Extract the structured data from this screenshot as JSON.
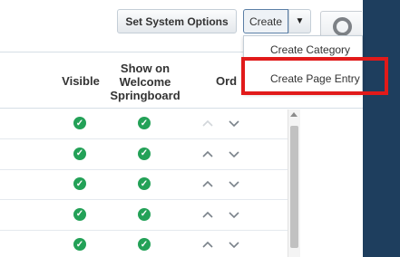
{
  "toolbar": {
    "system_options_label": "Set System Options",
    "create_label": "Create",
    "caret": "▼"
  },
  "create_menu": {
    "items": [
      "Create Category",
      "Create Page Entry"
    ],
    "highlighted_item": "Create Page Entry",
    "highlight_color": "#e11a1a"
  },
  "table": {
    "columns": [
      "Visible",
      "Show on Welcome Springboard",
      "Ord"
    ],
    "rows": [
      {
        "visible": true,
        "show_on_welcome": true
      },
      {
        "visible": true,
        "show_on_welcome": true
      },
      {
        "visible": true,
        "show_on_welcome": true
      },
      {
        "visible": true,
        "show_on_welcome": true
      },
      {
        "visible": true,
        "show_on_welcome": true
      }
    ],
    "check_icon": "check-circle-icon",
    "check_color": "#23a157"
  },
  "accent_colors": {
    "sidebar": "#1e3e5e"
  }
}
